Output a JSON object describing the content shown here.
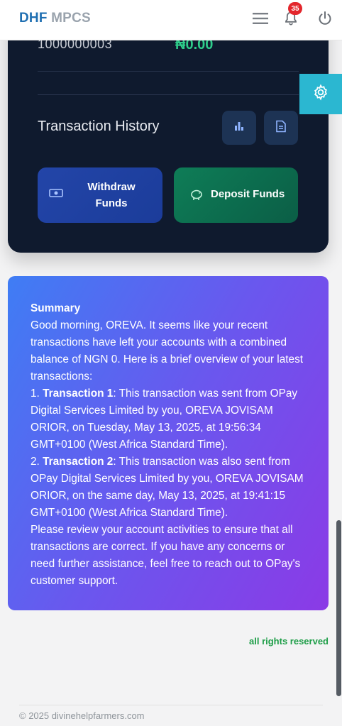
{
  "header": {
    "brand_part1": "DHF",
    "brand_part2": "MPCS",
    "notification_count": "35",
    "icons": [
      "menu-icon",
      "bell-icon",
      "power-icon"
    ]
  },
  "account": {
    "number": "1000000003",
    "balance": "₦0.00"
  },
  "transaction_history": {
    "title": "Transaction History",
    "icons": [
      "bar-chart-icon",
      "document-icon"
    ]
  },
  "actions": {
    "withdraw_line1": "Withdraw",
    "withdraw_line2": "Funds",
    "deposit_label": "Deposit Funds",
    "icons": [
      "cash-icon",
      "piggy-bank-icon"
    ]
  },
  "settings": {
    "icon": "gear-icon"
  },
  "summary": {
    "heading": "Summary",
    "intro": "Good morning, OREVA. It seems like your recent transactions have left your accounts with a combined balance of NGN 0. Here is a brief overview of your latest transactions:",
    "t1_prefix": "1. ",
    "t1_label": "Transaction 1",
    "t1_text": ": This transaction was sent from OPay Digital Services Limited by you, OREVA JOVISAM ORIOR, on Tuesday, May 13, 2025, at 19:56:34 GMT+0100 (West Africa Standard Time).",
    "t2_prefix": "2. ",
    "t2_label": "Transaction 2",
    "t2_text": ": This transaction was also sent from OPay Digital Services Limited by you, OREVA JOVISAM ORIOR, on the same day, May 13, 2025, at 19:41:15 GMT+0100 (West Africa Standard Time).",
    "closing": "Please review your account activities to ensure that all transactions are correct. If you have any concerns or need further assistance, feel free to reach out to OPay's customer support."
  },
  "footer": {
    "rights": "all rights reserved",
    "copyright": "© 2025 divinehelpfarmers.com"
  },
  "colors": {
    "brand_blue": "#1f6fb2",
    "dark_card": "#0f1a2e",
    "balance_green": "#2ecc8a",
    "settings_cyan": "#2bb7d1",
    "rights_green": "#1e9e48"
  }
}
